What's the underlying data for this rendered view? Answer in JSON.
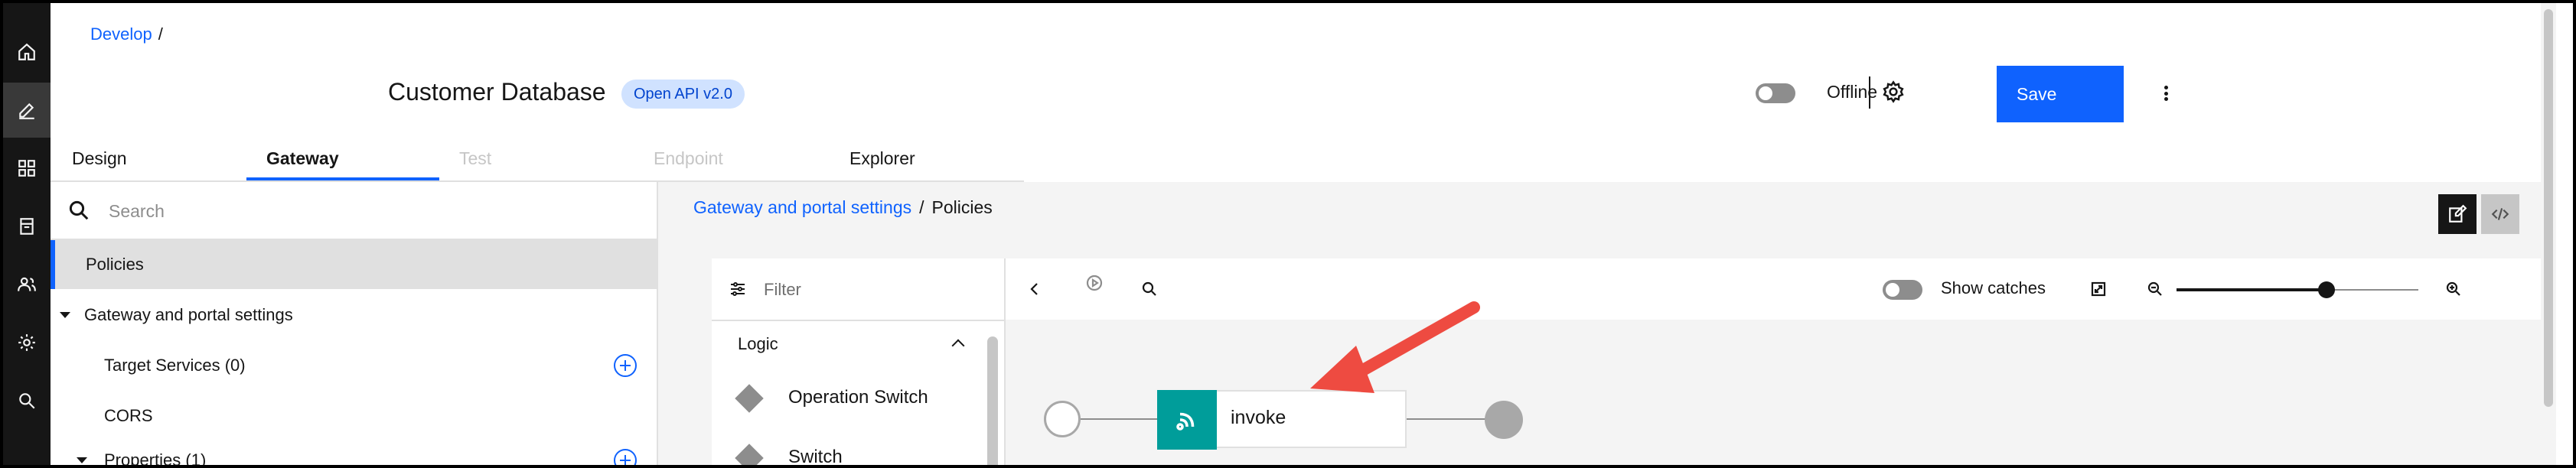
{
  "header": {
    "breadcrumb": "Develop",
    "breadcrumb_sep": "/",
    "api_title": "Customer Database",
    "badge": "Open API v2.0",
    "offline_label": "Offline",
    "save_label": "Save"
  },
  "tabs": [
    {
      "label": "Design",
      "state": "normal"
    },
    {
      "label": "Gateway",
      "state": "active"
    },
    {
      "label": "Test",
      "state": "disabled"
    },
    {
      "label": "Endpoint",
      "state": "disabled"
    },
    {
      "label": "Explorer",
      "state": "normal"
    }
  ],
  "left_nav": {
    "search_placeholder": "Search",
    "selected": "Policies",
    "group": "Gateway and portal settings",
    "items": [
      {
        "label": "Target Services (0)"
      },
      {
        "label": "CORS"
      },
      {
        "label": "Properties (1)"
      }
    ]
  },
  "right": {
    "breadcrumb_link": "Gateway and portal settings",
    "breadcrumb_sep": "/",
    "breadcrumb_current": "Policies"
  },
  "palette": {
    "filter_placeholder": "Filter",
    "section": "Logic",
    "items": [
      {
        "label": "Operation Switch"
      },
      {
        "label": "Switch"
      }
    ]
  },
  "toolbar": {
    "show_catches_label": "Show catches",
    "zoom_level": 0.62
  },
  "flow": {
    "node_label": "invoke"
  },
  "colors": {
    "accent": "#0f62fe",
    "rail": "#161616",
    "badge_bg": "#d0e2ff",
    "invoke": "#009d9a",
    "annotation_arrow": "#ee4b41"
  }
}
